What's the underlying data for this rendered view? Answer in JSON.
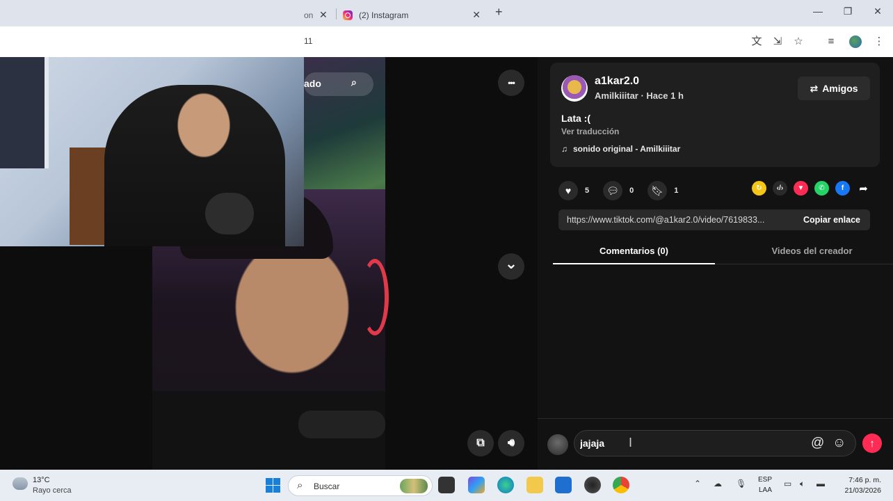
{
  "browser": {
    "prev_tab_title": "on",
    "active_tab_title": "(2) Instagram",
    "new_tab_label": "+",
    "url_fragment": "11",
    "window_controls": {
      "minimize": "—",
      "maximize": "❐",
      "close": "✕"
    }
  },
  "video": {
    "overlay_search_text": "ado",
    "more_icon": "•••",
    "down_icon": "⌄"
  },
  "post": {
    "username": "a1kar2.0",
    "subtitle": "Amilkiiitar · Hace 1 h",
    "friends_label": "Amigos",
    "caption": "Lata :(",
    "translate": "Ver traducción",
    "sound": "sonido original - Amilkiiitar",
    "likes": "5",
    "comments": "0",
    "saves": "1",
    "link": "https://www.tiktok.com/@a1kar2.0/video/7619833...",
    "copy_label": "Copiar enlace",
    "tab_comments": "Comentarios (0)",
    "tab_creator": "Videos del creador",
    "comment_value": "jajaja"
  },
  "taskbar": {
    "temp": "13°C",
    "weather": "Rayo cerca",
    "search_placeholder": "Buscar",
    "lang1": "ESP",
    "lang2": "LAA",
    "time": "7:46 p. m.",
    "date": "21/03/2026"
  },
  "colors": {
    "accent": "#fe2c55",
    "panel_bg": "#121212",
    "card_bg": "#1f1f1f"
  },
  "icons": [
    "instagram-icon",
    "translate-icon",
    "install-icon",
    "star-icon",
    "media-icon",
    "profile-icon",
    "more-icon",
    "chevron-down-icon",
    "heart-icon",
    "comment-icon",
    "bookmark-icon",
    "swap-icon",
    "music-icon",
    "at-icon",
    "emoji-icon",
    "arrow-up-icon",
    "windows-icon",
    "search-icon"
  ]
}
